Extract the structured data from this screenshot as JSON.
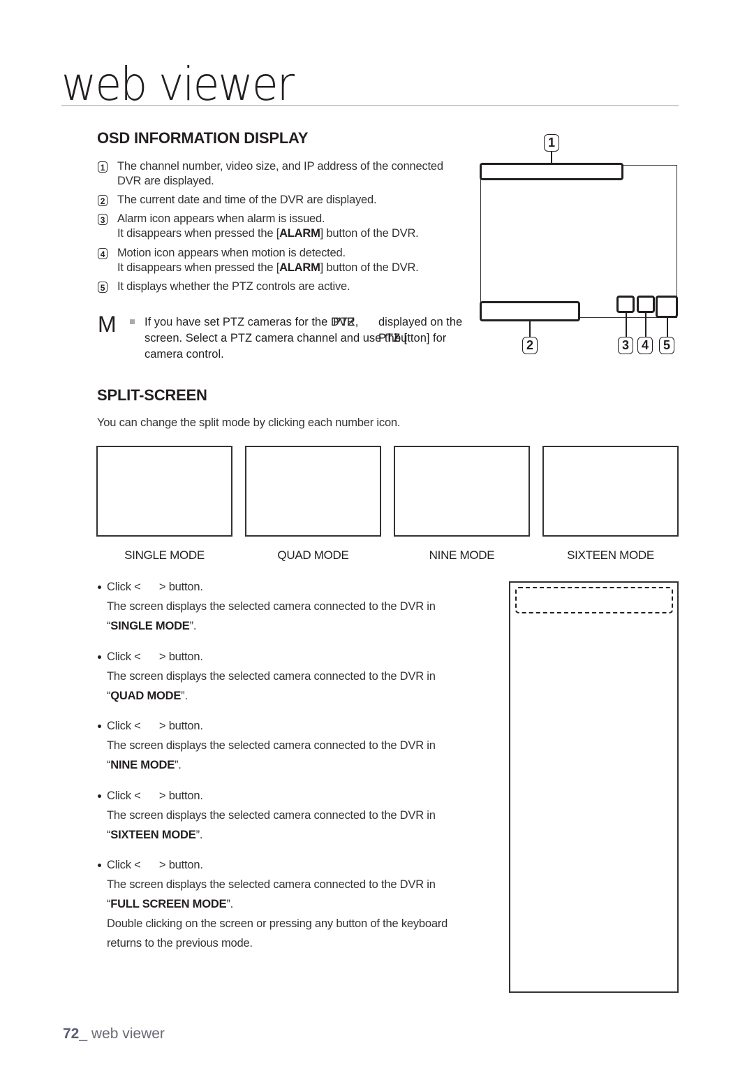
{
  "page": {
    "chapter_title": "web viewer",
    "footer": {
      "page_number": "72",
      "separator": "_",
      "section": " web viewer"
    }
  },
  "osd": {
    "heading": "OSD INFORMATION DISPLAY",
    "items": [
      {
        "num": "1",
        "lines": [
          "The channel number, video size, and IP address of the connected",
          "DVR are displayed."
        ]
      },
      {
        "num": "2",
        "lines": [
          "The current date and time of the DVR are displayed."
        ]
      },
      {
        "num": "3",
        "lines": [
          "Alarm icon appears when alarm is issued.",
          "It disappears when pressed the [",
          "ALARM",
          "] button of the DVR."
        ]
      },
      {
        "num": "4",
        "lines": [
          "Motion icon appears when motion is detected.",
          "It disappears when pressed the [",
          "ALARM",
          "] button of the DVR."
        ]
      },
      {
        "num": "5",
        "lines": [
          "It displays whether the PTZ controls are active."
        ]
      }
    ],
    "note": {
      "marker": "M",
      "line1_a": "If you have set PTZ cameras for the DVR,",
      "line1_overlay": "PTZ",
      "line1_b": "displayed on the",
      "line2_a": "screen. Select a PTZ camera channel and use the [",
      "line2_overlay": "PTZ",
      "line2_b": "button] for",
      "line3": "camera control."
    },
    "diagram_callouts": {
      "c1": "1",
      "c2": "2",
      "c3": "3",
      "c4": "4",
      "c5": "5"
    }
  },
  "split": {
    "heading": "SPLIT-SCREEN",
    "intro": "You can change the split mode by clicking each number icon.",
    "modes": [
      {
        "label": "SINGLE MODE"
      },
      {
        "label": "QUAD MODE"
      },
      {
        "label": "NINE MODE"
      },
      {
        "label": "SIXTEEN MODE"
      }
    ],
    "bullets": [
      {
        "click": "Click <      > button.",
        "desc": "The screen displays the selected camera connected to the DVR in",
        "mode_open": "“",
        "mode": "SINGLE MODE",
        "mode_close": "”.",
        "extra": ""
      },
      {
        "click": "Click <      > button.",
        "desc": "The screen displays the selected camera connected to the DVR in",
        "mode_open": "“",
        "mode": "QUAD MODE",
        "mode_close": "”.",
        "extra": ""
      },
      {
        "click": "Click <      > button.",
        "desc": "The screen displays the selected camera connected to the DVR in",
        "mode_open": "“",
        "mode": "NINE MODE",
        "mode_close": "”.",
        "extra": ""
      },
      {
        "click": "Click <      > button.",
        "desc": "The screen displays the selected camera connected to the DVR in",
        "mode_open": "“",
        "mode": "SIXTEEN MODE",
        "mode_close": "”.",
        "extra": ""
      },
      {
        "click": "Click <      > button.",
        "desc": "The screen displays the selected camera connected to the DVR in",
        "mode_open": "“",
        "mode": "FULL SCREEN MODE",
        "mode_close": "”.",
        "extra1": "Double clicking on the screen or pressing any button of the keyboard",
        "extra2": "returns to the previous mode."
      }
    ]
  }
}
